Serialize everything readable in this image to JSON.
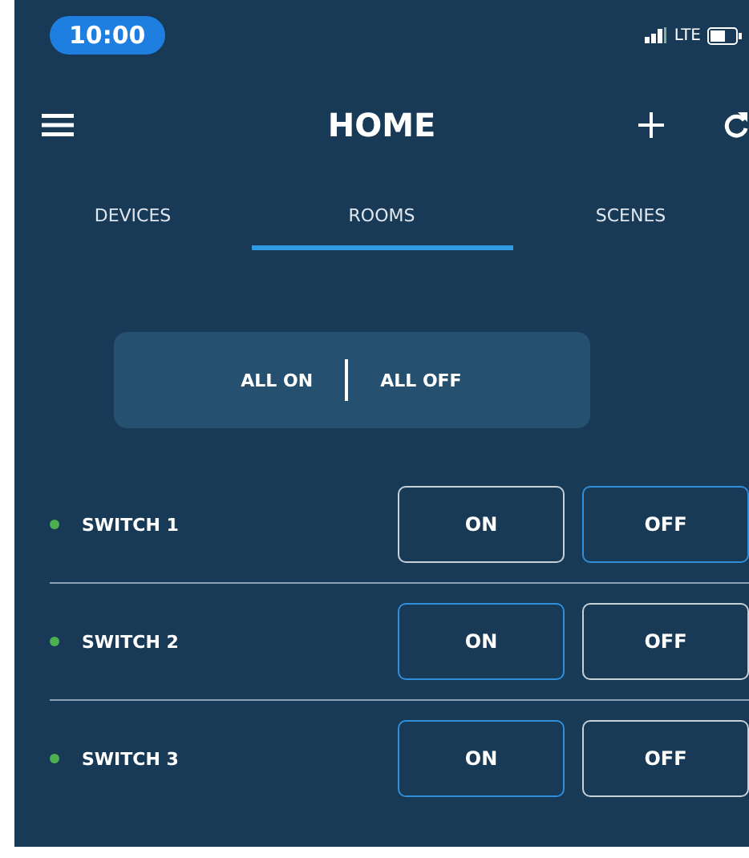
{
  "status_bar": {
    "time": "10:00",
    "network": "LTE"
  },
  "header": {
    "title": "HOME"
  },
  "tabs": [
    {
      "label": "DEVICES",
      "selected": false
    },
    {
      "label": "ROOMS",
      "selected": true
    },
    {
      "label": "SCENES",
      "selected": false
    }
  ],
  "bulk_actions": [
    "ALL ON",
    "ALL OFF"
  ],
  "switches": [
    {
      "name": "SWITCH 1",
      "buttons": [
        {
          "label": "ON",
          "selected": false
        },
        {
          "label": "OFF",
          "selected": true
        }
      ]
    },
    {
      "name": "SWITCH 2",
      "buttons": [
        {
          "label": "ON",
          "selected": true
        },
        {
          "label": "OFF",
          "selected": false
        }
      ]
    },
    {
      "name": "SWITCH 3",
      "buttons": [
        {
          "label": "ON",
          "selected": true
        },
        {
          "label": "OFF",
          "selected": false
        }
      ]
    }
  ]
}
